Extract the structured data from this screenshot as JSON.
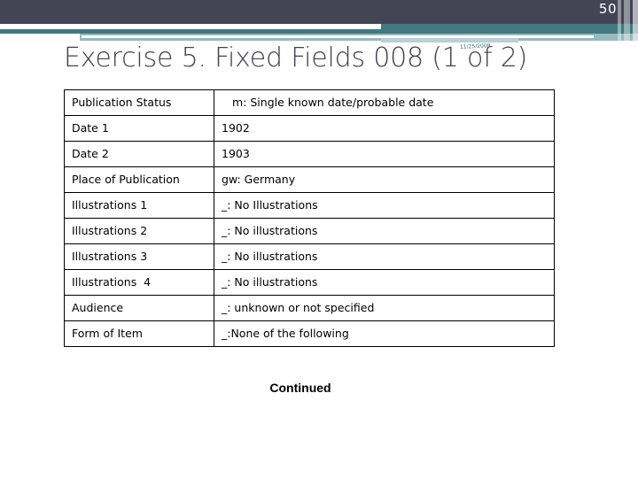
{
  "banner": {
    "colors": {
      "dark_slate": "#434555",
      "teal": "#417a80",
      "light_blue": "#95b9be",
      "pale_blue": "#b9d0d4",
      "white": "#ffffff"
    }
  },
  "page_number": "50",
  "title": {
    "text": "Exercise 5. Fixed Fields 008 (1 of 2)",
    "color": "#40414f"
  },
  "datestamp": {
    "text": "11/25/2008",
    "color": "#2f6f77"
  },
  "table": {
    "rows": [
      {
        "label": "Publication Status",
        "value": "m: Single known date/probable date"
      },
      {
        "label": "Date 1",
        "value": "1902"
      },
      {
        "label": "Date 2",
        "value": "1903"
      },
      {
        "label": "Place of Publication",
        "value": "gw: Germany"
      },
      {
        "label": "Illustrations 1",
        "value": "_: No Illustrations"
      },
      {
        "label": "Illustrations 2",
        "value": "_: No illustrations"
      },
      {
        "label": "Illustrations 3",
        "value": "_: No illustrations"
      },
      {
        "label": "Illustrations  4",
        "value": "_: No illustrations"
      },
      {
        "label": "Audience",
        "value": "_: unknown or not specified"
      },
      {
        "label": "Form of Item",
        "value": "_:None of the following"
      }
    ]
  },
  "footer": {
    "continued_label": "Continued"
  }
}
